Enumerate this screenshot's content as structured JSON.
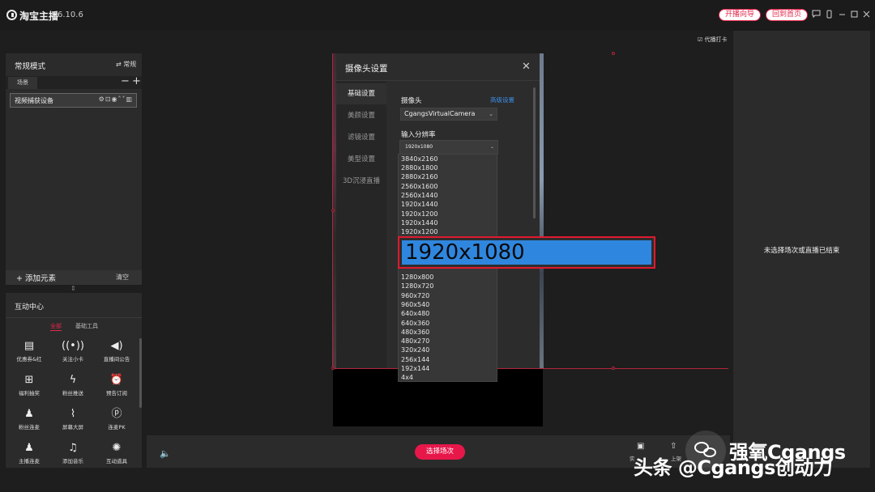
{
  "titlebar": {
    "app_name": "淘宝主播",
    "version": "6.10.6",
    "guide_btn": "开播向导",
    "home_btn": "回到首页"
  },
  "left_panel": {
    "mode_title": "常规模式",
    "mode_switch": "⇄ 常规",
    "scene_tab": "场景",
    "device_name": "视频捕获设备",
    "add_element": "+ 添加元素",
    "clear": "清空"
  },
  "interact": {
    "title": "互动中心",
    "tab_all": "全部",
    "tab_basic": "基础工具",
    "tools": [
      {
        "label": "优惠券&红",
        "icon": "ticket-icon"
      },
      {
        "label": "关注小卡",
        "icon": "broadcast-icon"
      },
      {
        "label": "直播间公告",
        "icon": "speaker-icon"
      },
      {
        "label": "福利抽奖",
        "icon": "gift-icon"
      },
      {
        "label": "粉丝推送",
        "icon": "bolt-icon"
      },
      {
        "label": "预告订阅",
        "icon": "alarm-icon"
      },
      {
        "label": "粉丝连麦",
        "icon": "user-plus-icon"
      },
      {
        "label": "屏幕大屏",
        "icon": "chart-icon"
      },
      {
        "label": "连麦PK",
        "icon": "pk-icon"
      },
      {
        "label": "主播连麦",
        "icon": "user-link-icon"
      },
      {
        "label": "添加音乐",
        "icon": "music-icon"
      },
      {
        "label": "互动道具",
        "icon": "dance-icon"
      }
    ]
  },
  "dialog": {
    "title": "摄像头设置",
    "nav": [
      "基础设置",
      "美颜设置",
      "滤镜设置",
      "美型设置",
      "3D沉浸直播"
    ],
    "camera_label": "摄像头",
    "advanced_link": "高级设置",
    "camera_value": "CgangsVirtualCamera",
    "resolution_label": "输入分辨率",
    "resolution_value": "1920x1080"
  },
  "resolutions_top": [
    "3840x2160",
    "2880x1800",
    "2880x2160",
    "2560x1600",
    "2560x1440",
    "1920x1440",
    "1920x1200",
    "1920x1440",
    "1920x1200"
  ],
  "resolution_highlight": "1920x1080",
  "resolutions_bottom": [
    "1280x800",
    "1280x720",
    "960x720",
    "960x540",
    "640x480",
    "640x360",
    "480x360",
    "480x270",
    "320x240",
    "256x144",
    "192x144",
    "4x4"
  ],
  "bottom_bar": {
    "select_scene": "选择场次",
    "label1": "实",
    "label2": "上架"
  },
  "right_panel": {
    "checkin": "代播打卡",
    "empty_text": "未选择场次或直播已结束"
  },
  "watermark": {
    "brand": "强氧Cgangs",
    "credit": "头条 @Cgangs创动力"
  }
}
